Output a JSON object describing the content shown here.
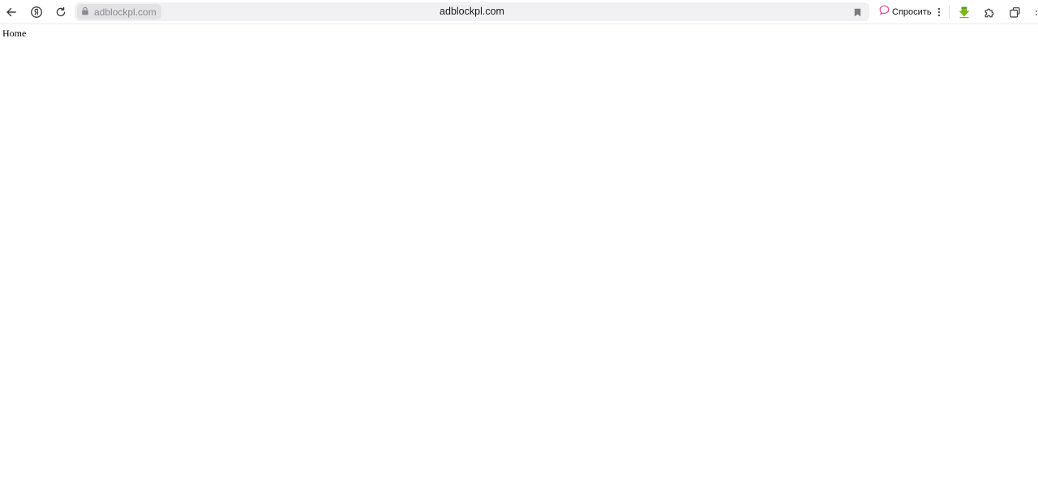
{
  "browser": {
    "nav": {
      "back_icon": "back-arrow-icon",
      "yandex_icon": "yandex-logo-icon",
      "reload_icon": "reload-icon"
    },
    "address_bar": {
      "lock_icon": "lock-icon",
      "domain_chip": "adblockpl.com",
      "page_host": "adblockpl.com",
      "bookmark_icon": "bookmark-icon"
    },
    "ask_button": {
      "icon": "alice-chat-icon",
      "label": "Спросить"
    },
    "menu_icon": "kebab-menu-icon",
    "extensions": {
      "download_icon": "download-arrow-icon",
      "puzzle_icon": "extensions-puzzle-icon",
      "panel_icon": "side-panel-icon"
    },
    "colors": {
      "download_green": "#7cb518",
      "ask_pink": "#e0458e",
      "icon_gray": "#4a4a4a"
    }
  },
  "page": {
    "home_link": "Home"
  }
}
